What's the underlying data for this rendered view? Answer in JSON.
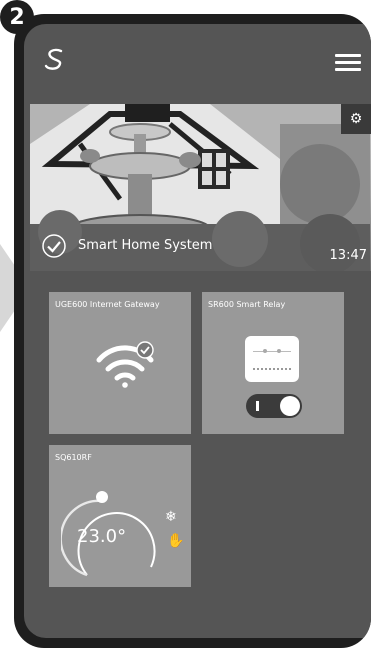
{
  "step_number": "2",
  "header": {
    "logo_icon": "salus-logo-icon",
    "menu_icon": "hamburger-menu-icon"
  },
  "banner": {
    "title": "Smart Home System",
    "time": "13:47",
    "settings_icon": "gear-icon",
    "status_icon": "check-circle-icon"
  },
  "tiles": [
    {
      "label": "UGE600 Internet Gateway",
      "icon": "wifi-icon",
      "badge_icon": "check-circle-icon"
    },
    {
      "label": "SR600 Smart Relay",
      "icon": "relay-icon",
      "toggle_icon": "toggle-switch-icon"
    },
    {
      "label": "SQ610RF",
      "temperature": "23.0°",
      "mode_icon": "snowflake-icon",
      "manual_icon": "hand-icon"
    }
  ],
  "colors": {
    "phone_frame": "#1e1e1e",
    "screen_bg": "#555555",
    "tile_bg": "#999999",
    "text": "#ffffff"
  }
}
